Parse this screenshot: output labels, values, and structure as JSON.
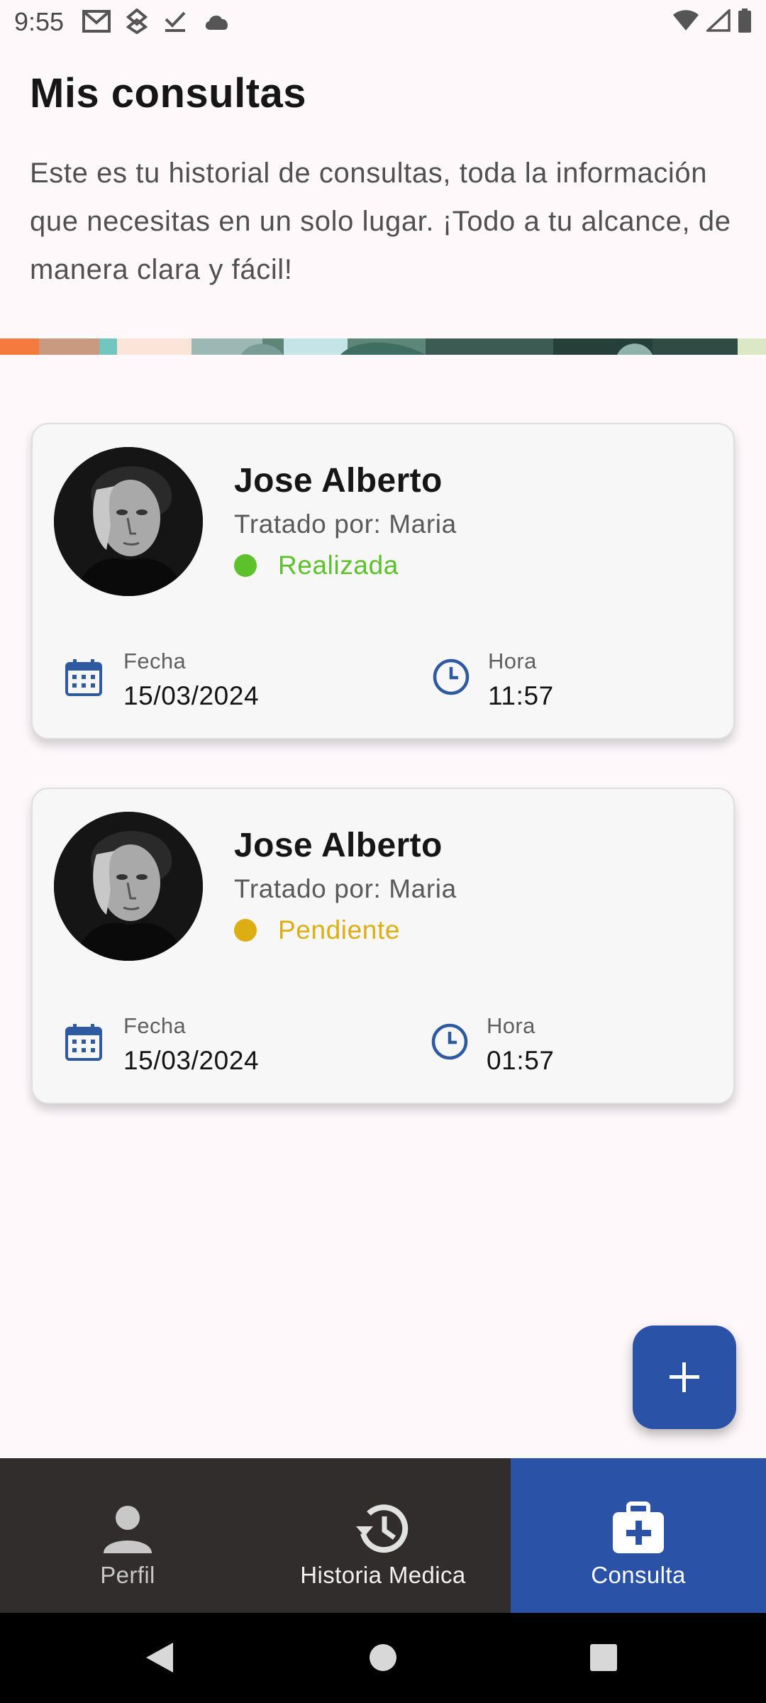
{
  "status_bar": {
    "time": "9:55",
    "left_icons": [
      "gmail-icon",
      "fitness-icon",
      "task-done-icon",
      "cloud-icon"
    ],
    "right_icons": [
      "wifi-icon",
      "signal-icon",
      "battery-icon"
    ]
  },
  "header": {
    "title": "Mis consultas",
    "description": "Este es tu historial de consultas, toda la información que necesitas en un solo lugar. ¡Todo a tu alcance, de manera clara y fácil!"
  },
  "consultations": [
    {
      "patient_name": "Jose Alberto",
      "treated_by": "Tratado por: Maria",
      "status": "Realizada",
      "status_color": "#5cc12a",
      "date_label": "Fecha",
      "date": "15/03/2024",
      "time_label": "Hora",
      "time": "11:57"
    },
    {
      "patient_name": "Jose Alberto",
      "treated_by": "Tratado por: Maria",
      "status": "Pendiente",
      "status_color": "#dcae14",
      "date_label": "Fecha",
      "date": "15/03/2024",
      "time_label": "Hora",
      "time": "01:57"
    }
  ],
  "fab": {
    "icon": "plus-icon"
  },
  "bottom_nav": {
    "items": [
      {
        "label": "Perfil",
        "icon": "person-icon",
        "active": false
      },
      {
        "label": "Historia Medica",
        "icon": "history-icon",
        "active": false
      },
      {
        "label": "Consulta",
        "icon": "medical-bag-icon",
        "active": true
      }
    ]
  },
  "system_nav": {
    "buttons": [
      "back-icon",
      "home-icon",
      "recents-icon"
    ]
  },
  "colors": {
    "accent": "#2a52a6",
    "nav_background": "#312d2c",
    "page_background": "#fef8fb",
    "card_background": "#f7f7f7",
    "icon_blue": "#2d5aa0"
  }
}
